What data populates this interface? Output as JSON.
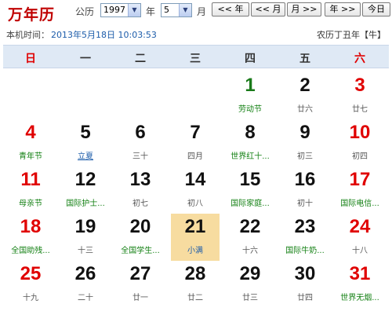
{
  "header": {
    "logo": "万年历",
    "calendar_type_label": "公历",
    "year_value": "1997",
    "year_label": "年",
    "month_value": "5",
    "month_label": "月",
    "nav_buttons": [
      "<< 年",
      "<< 月",
      "月 >>",
      "年 >>",
      "今日"
    ]
  },
  "status": {
    "time_label": "本机时间：",
    "time_value": "2013年5月18日 10:03:53",
    "lunar_year": "农历丁丑年【牛】"
  },
  "colors": {
    "weekend_red": "#e00000",
    "festival_green": "#138013",
    "solar_term_blue": "#1c5caa",
    "today_highlight": "#f7dca0",
    "weekday_bar": "#dfe9f5"
  },
  "weekdays": [
    "日",
    "一",
    "二",
    "三",
    "四",
    "五",
    "六"
  ],
  "days": [
    {
      "day": "1",
      "sub": "劳动节",
      "num_style": "green",
      "sub_style": "fest"
    },
    {
      "day": "2",
      "sub": "廿六",
      "num_style": "",
      "sub_style": ""
    },
    {
      "day": "3",
      "sub": "廿七",
      "num_style": "red",
      "sub_style": ""
    },
    {
      "day": "4",
      "sub": "青年节",
      "num_style": "red",
      "sub_style": "fest"
    },
    {
      "day": "5",
      "sub": "立夏",
      "num_style": "",
      "sub_style": "term"
    },
    {
      "day": "6",
      "sub": "三十",
      "num_style": "",
      "sub_style": ""
    },
    {
      "day": "7",
      "sub": "四月",
      "num_style": "",
      "sub_style": ""
    },
    {
      "day": "8",
      "sub": "世界红十...",
      "num_style": "",
      "sub_style": "fest"
    },
    {
      "day": "9",
      "sub": "初三",
      "num_style": "",
      "sub_style": ""
    },
    {
      "day": "10",
      "sub": "初四",
      "num_style": "red",
      "sub_style": ""
    },
    {
      "day": "11",
      "sub": "母亲节",
      "num_style": "red",
      "sub_style": "fest"
    },
    {
      "day": "12",
      "sub": "国际护士...",
      "num_style": "",
      "sub_style": "fest"
    },
    {
      "day": "13",
      "sub": "初七",
      "num_style": "",
      "sub_style": ""
    },
    {
      "day": "14",
      "sub": "初八",
      "num_style": "",
      "sub_style": ""
    },
    {
      "day": "15",
      "sub": "国际家庭...",
      "num_style": "",
      "sub_style": "fest"
    },
    {
      "day": "16",
      "sub": "初十",
      "num_style": "",
      "sub_style": ""
    },
    {
      "day": "17",
      "sub": "国际电信...",
      "num_style": "red",
      "sub_style": "fest"
    },
    {
      "day": "18",
      "sub": "全国助残...",
      "num_style": "red",
      "sub_style": "fest"
    },
    {
      "day": "19",
      "sub": "十三",
      "num_style": "",
      "sub_style": ""
    },
    {
      "day": "20",
      "sub": "全国学生...",
      "num_style": "",
      "sub_style": "fest"
    },
    {
      "day": "21",
      "sub": "小满",
      "num_style": "",
      "sub_style": "term-today",
      "today": true
    },
    {
      "day": "22",
      "sub": "十六",
      "num_style": "",
      "sub_style": ""
    },
    {
      "day": "23",
      "sub": "国际牛奶...",
      "num_style": "",
      "sub_style": "fest"
    },
    {
      "day": "24",
      "sub": "十八",
      "num_style": "red",
      "sub_style": ""
    },
    {
      "day": "25",
      "sub": "十九",
      "num_style": "red",
      "sub_style": ""
    },
    {
      "day": "26",
      "sub": "二十",
      "num_style": "",
      "sub_style": ""
    },
    {
      "day": "27",
      "sub": "廿一",
      "num_style": "",
      "sub_style": ""
    },
    {
      "day": "28",
      "sub": "廿二",
      "num_style": "",
      "sub_style": ""
    },
    {
      "day": "29",
      "sub": "廿三",
      "num_style": "",
      "sub_style": ""
    },
    {
      "day": "30",
      "sub": "廿四",
      "num_style": "",
      "sub_style": ""
    },
    {
      "day": "31",
      "sub": "世界无烟...",
      "num_style": "red",
      "sub_style": "fest"
    }
  ]
}
